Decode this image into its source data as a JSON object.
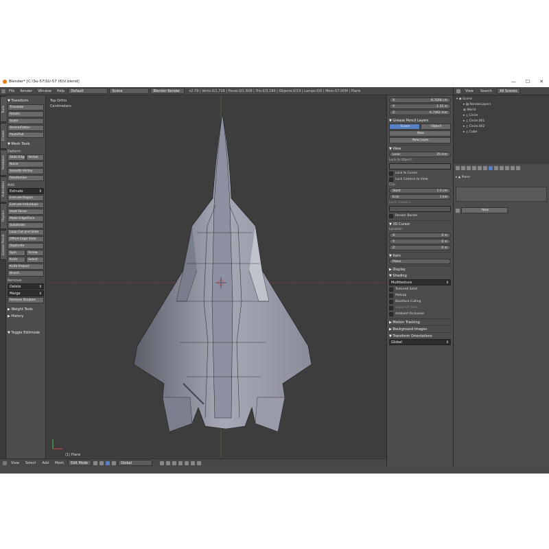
{
  "window": {
    "title": "Blender* [C:\\Su-57\\SU-57 (6)\\t.blend]",
    "controls": [
      "—",
      "☐",
      "✕"
    ]
  },
  "menubar": {
    "items": [
      "File",
      "Render",
      "Window",
      "Help"
    ],
    "screen": "Default",
    "scene": "Scene",
    "engine": "Blender Render",
    "stats": "v2.79 | Verts:0/1,728 | Faces:0/1,608 | Tris:0/3,180 | Objects:0/19 | Lamps:0/0 | Mem:57.00M | Plane"
  },
  "lefttabs": [
    "Tools",
    "Create",
    "Relations",
    "Animation",
    "Physics",
    "Grease Pencil"
  ],
  "toolshelf": {
    "transform_header": "▼ Transform",
    "transform": [
      "Translate",
      "Rotate",
      "Scale",
      "Shrink/Fatten",
      "Push/Pull"
    ],
    "mesh_tools_header": "▼ Mesh Tools",
    "deform_label": "Deform:",
    "deform_row": [
      "Slide Edge",
      "Vertex"
    ],
    "deform": [
      "Noise",
      "Smooth Vertex",
      "Randomize"
    ],
    "add_label": "Add:",
    "extrude": "Extrude",
    "add": [
      "Extrude Region",
      "Extrude Individual",
      "Inset Faces",
      "Make Edge/Face",
      "Subdivide",
      "Loop Cut and Slide",
      "Offset Edge Slide",
      "Duplicate"
    ],
    "row1": [
      "Spin",
      "Screw"
    ],
    "row2": [
      "Knife",
      "Select"
    ],
    "add2": [
      "Knife Project",
      "Bisect"
    ],
    "remove_label": "Remove:",
    "delete": "Delete",
    "merge": "Merge",
    "remove_doubles": "Remove Doubles",
    "weight_tools": "▶ Weight Tools",
    "history": "▶ History",
    "toggle": "▼ Toggle Editmode"
  },
  "viewport": {
    "view_name": "Top Ortho",
    "unit": "Centimeters",
    "object_label": "(1) Plane"
  },
  "bottombar": {
    "items": [
      "View",
      "Select",
      "Add",
      "Mesh"
    ],
    "mode": "Edit Mode",
    "orientation": "Global"
  },
  "props": {
    "x": "X:",
    "x_val": "8.7648 cm",
    "y": "Y:",
    "y_val": "1.55 m",
    "z": "Z:",
    "z_val": "6.7462 mm",
    "gp_header": "▼ Grease Pencil Layers",
    "scene_tab": "Scene",
    "object_tab": "Object",
    "new": "New",
    "new_layer": "New Layer",
    "view_header": "▼ View",
    "lens": "Lens:",
    "lens_val": "35 mm",
    "lock_object": "Lock to Object:",
    "lock_cursor": "Lock to Cursor",
    "lock_camera": "Lock Camera to View",
    "clip": "Clip:",
    "start": "Start:",
    "start_val": "1.0 cm",
    "end": "End:",
    "end_val": "1 km",
    "local_camera": "Local Camera:",
    "render_border": "Render Border",
    "cursor_header": "▼ 3D Cursor",
    "location": "Location:",
    "cx": "X:",
    "cx_val": "0 m",
    "cy": "Y:",
    "cy_val": "0 m",
    "cz": "Z:",
    "cz_val": "0 m",
    "item_header": "▼ Item",
    "item_name": "Plane",
    "display": "▶ Display",
    "shading": "▼ Shading",
    "shading_mode": "Multitexture",
    "textured_solid": "Textured Solid",
    "matcap": "Matcap",
    "backface": "Backface Culling",
    "depth_of_field": "Depth Of Field",
    "ambient": "Ambient Occlusion",
    "motion": "▶ Motion Tracking",
    "background": "▶ Background Images",
    "transform_orient": "▼ Transform Orientations",
    "global": "Global"
  },
  "outliner": {
    "view": "View",
    "search": "Search",
    "filter": "All Scenes",
    "items": [
      "Scene",
      "RenderLayers",
      "World",
      "Circle",
      "Circle.001",
      "Circle.002",
      "Cube"
    ]
  },
  "propeditor": {
    "path": "Plane",
    "new": "New"
  }
}
